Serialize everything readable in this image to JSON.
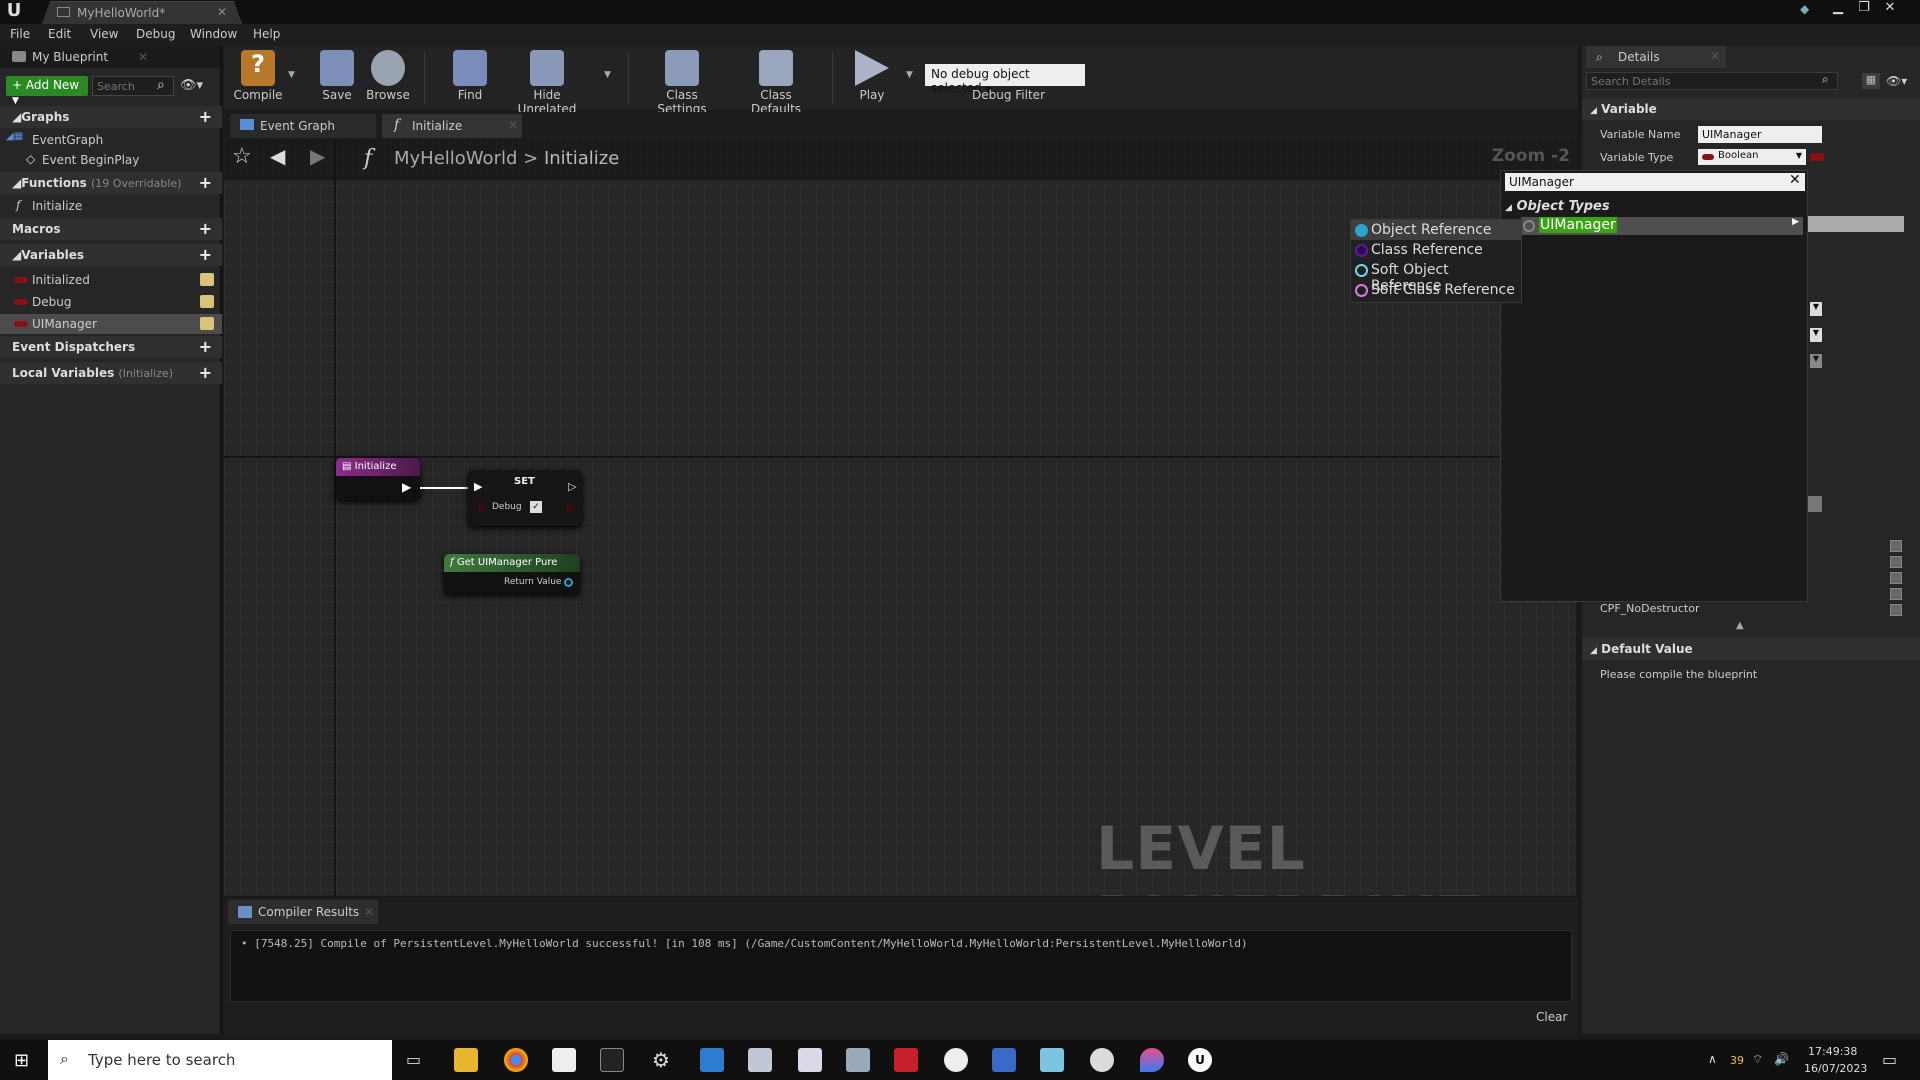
{
  "window": {
    "tab_title": "MyHelloWorld*",
    "close_glyph": "✕"
  },
  "menu": [
    "File",
    "Edit",
    "View",
    "Debug",
    "Window",
    "Help"
  ],
  "left": {
    "tab": "My Blueprint",
    "add_new": "Add New",
    "search_placeholder": "Search",
    "graphs": "Graphs",
    "event_graph": "EventGraph",
    "begin_play": "Event BeginPlay",
    "functions": "Functions",
    "functions_sub": "(19 Overridable)",
    "fn_initialize": "Initialize",
    "macros": "Macros",
    "variables": "Variables",
    "vars": [
      "Initialized",
      "Debug",
      "UIManager"
    ],
    "dispatchers": "Event Dispatchers",
    "locals": "Local Variables",
    "locals_sub": "(Initialize)"
  },
  "toolbar": {
    "compile": "Compile",
    "save": "Save",
    "browse": "Browse",
    "find": "Find",
    "hide": "Hide Unrelated",
    "class_settings": "Class Settings",
    "class_defaults": "Class Defaults",
    "play": "Play",
    "debug_select": "No debug object selected",
    "debug_filter": "Debug Filter"
  },
  "graph": {
    "tab_event": "Event Graph",
    "tab_init": "Initialize",
    "crumb_root": "MyHelloWorld",
    "crumb_sep": ">",
    "crumb_fn": "Initialize",
    "zoom": "Zoom -2",
    "watermark": "LEVEL BLUEPRINT",
    "node_init": "Initialize",
    "node_set": "SET",
    "node_set_pin": "Debug",
    "node_get": "Get UIManager Pure",
    "node_get_pin": "Return Value"
  },
  "compiler": {
    "tab": "Compiler Results",
    "log": "[7548.25] Compile of PersistentLevel.MyHelloWorld successful! [in 108 ms] (/Game/CustomContent/MyHelloWorld.MyHelloWorld:PersistentLevel.MyHelloWorld)",
    "clear": "Clear"
  },
  "details": {
    "tab": "Details",
    "search_placeholder": "Search Details",
    "variable": "Variable",
    "var_name_label": "Variable Name",
    "var_name": "UIManager",
    "var_type_label": "Variable Type",
    "var_type": "Boolean",
    "cpf": "CPF_NoDestructor",
    "default_value": "Default Value",
    "compile_msg": "Please compile the blueprint"
  },
  "popup": {
    "query": "UIManager",
    "category": "Object Types",
    "result": "UIManager",
    "sub": [
      "Object Reference",
      "Class Reference",
      "Soft Object Reference",
      "Soft Class Reference"
    ]
  },
  "taskbar": {
    "search": "Type here to search",
    "temp": "39",
    "time": "17:49:38",
    "date": "16/07/2023"
  },
  "colors": {
    "bool_pin": "#8c0f14",
    "object_ref": "#2ea3c9",
    "class_ref": "#5b1b9e",
    "soft_obj": "#6fd6e6",
    "soft_class": "#e07ae0",
    "highlight": "#3aa415"
  }
}
